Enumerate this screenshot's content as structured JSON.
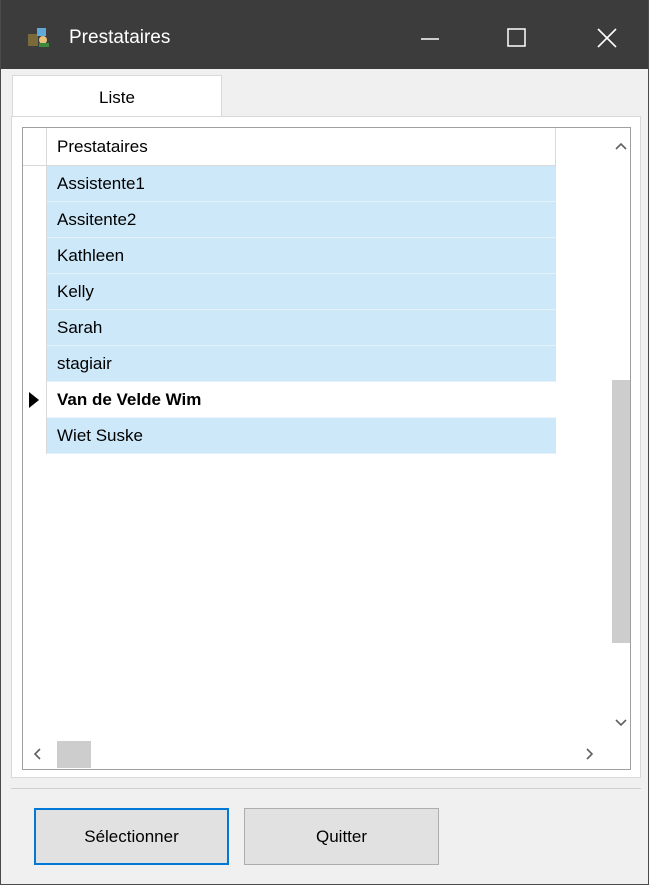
{
  "window": {
    "title": "Prestataires",
    "colors": {
      "titlebar": "#3c3c3c",
      "selection": "#cce8f9",
      "accent": "#0078d7"
    }
  },
  "tabs": [
    {
      "label": "Liste",
      "active": true
    }
  ],
  "grid": {
    "column_header": "Prestataires",
    "rows": [
      {
        "name": "Assistente1",
        "current": false
      },
      {
        "name": "Assitente2",
        "current": false
      },
      {
        "name": "Kathleen",
        "current": false
      },
      {
        "name": "Kelly",
        "current": false
      },
      {
        "name": "Sarah",
        "current": false
      },
      {
        "name": "stagiair",
        "current": false
      },
      {
        "name": "Van de Velde Wim",
        "current": true
      },
      {
        "name": "Wiet Suske",
        "current": false
      }
    ]
  },
  "buttons": {
    "select_label": "Sélectionner",
    "quit_label": "Quitter"
  },
  "icons": {
    "app": "prestataires-app-icon",
    "minimize": "minimize-icon",
    "maximize": "maximize-icon",
    "close": "close-icon",
    "row_pointer": "row-pointer-icon",
    "scroll_up": "chevron-up-icon",
    "scroll_down": "chevron-down-icon",
    "scroll_left": "chevron-left-icon",
    "scroll_right": "chevron-right-icon"
  }
}
